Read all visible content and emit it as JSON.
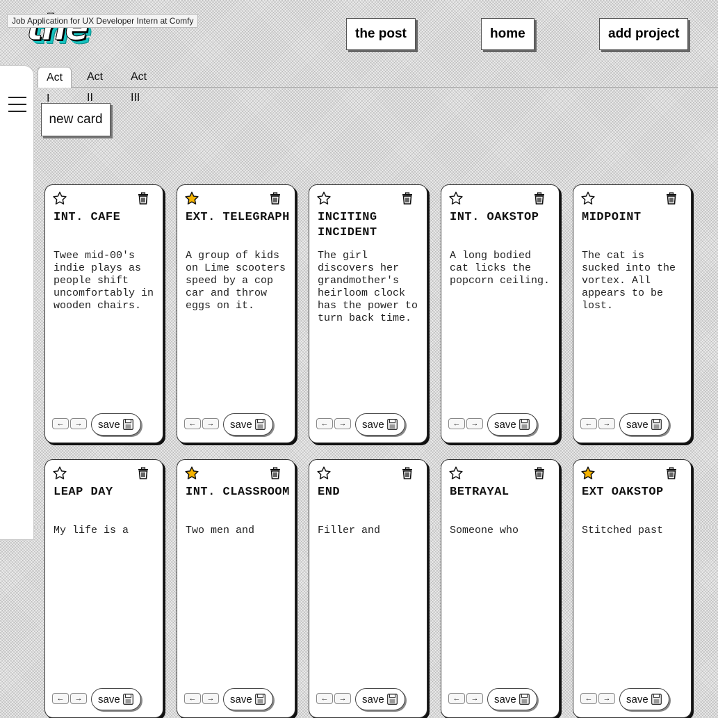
{
  "logo": "the scratchPost",
  "tooltip": "Job Application for UX Developer Intern at Comfy",
  "nav": {
    "the_post": "the post",
    "home": "home",
    "add_project": "add project"
  },
  "tabs": [
    "Act I",
    "Act II",
    "Act III"
  ],
  "new_card": "new card",
  "save_label": "save",
  "arrows": {
    "left": "←",
    "right": "→"
  },
  "colors": {
    "accent": "#17c3c0",
    "star_filled": "#f5b301"
  },
  "cards": [
    {
      "title": "INT. CAFE",
      "body": "Twee mid-00's indie plays as people shift uncomfortably in wooden chairs.",
      "starred": false
    },
    {
      "title": "EXT. TELEGRAPH",
      "body": "A group of kids on Lime scooters speed by a cop car and throw eggs on it.",
      "starred": true
    },
    {
      "title": "INCITING INCIDENT",
      "body": "The girl discovers her grandmother's heirloom clock has the power to turn back time.",
      "starred": false
    },
    {
      "title": "INT. OAKSTOP",
      "body": "A long bodied cat licks the popcorn ceiling.",
      "starred": false
    },
    {
      "title": "MIDPOINT",
      "body": "The cat is sucked into the vortex. All appears to be lost.",
      "starred": false
    },
    {
      "title": "LEAP DAY",
      "body": "My life is a",
      "starred": false
    },
    {
      "title": "INT. CLASSROOM",
      "body": "Two men and",
      "starred": true
    },
    {
      "title": "END",
      "body": "Filler and",
      "starred": false
    },
    {
      "title": "BETRAYAL",
      "body": "Someone who",
      "starred": false
    },
    {
      "title": "EXT OAKSTOP",
      "body": "Stitched past",
      "starred": true
    }
  ]
}
